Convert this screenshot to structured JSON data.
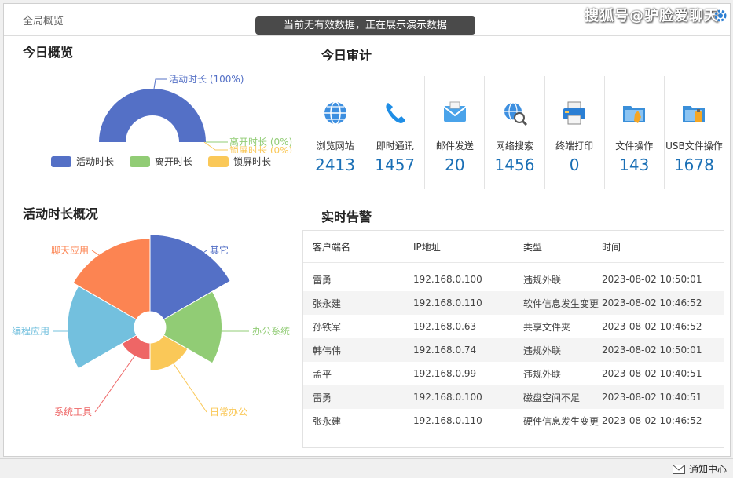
{
  "header": {
    "breadcrumb": "全局概览",
    "toast": "当前无有效数据，正在展示演示数据",
    "watermark": "搜狐号@驴脸爱聊天"
  },
  "overview": {
    "title": "今日概览",
    "chart_data": {
      "type": "pie",
      "title": "",
      "variant": "half-donut",
      "categories": [
        "活动时长",
        "离开时长",
        "锁屏时长"
      ],
      "values": [
        100,
        0,
        0
      ],
      "labels": [
        "活动时长 (100%)",
        "离开时长 (0%)",
        "锁屏时长 (0%)"
      ],
      "colors": [
        "#5470c6",
        "#91cc75",
        "#fac858"
      ],
      "legend_position": "bottom"
    }
  },
  "audit": {
    "title": "今日审计",
    "items": [
      {
        "label": "浏览网站",
        "value": "2413",
        "icon": "globe-icon"
      },
      {
        "label": "即时通讯",
        "value": "1457",
        "icon": "phone-icon"
      },
      {
        "label": "邮件发送",
        "value": "20",
        "icon": "mail-icon"
      },
      {
        "label": "网络搜索",
        "value": "1456",
        "icon": "search-globe-icon"
      },
      {
        "label": "终端打印",
        "value": "0",
        "icon": "printer-icon"
      },
      {
        "label": "文件操作",
        "value": "143",
        "icon": "folder-icon"
      },
      {
        "label": "USB文件操作",
        "value": "1678",
        "icon": "usb-folder-icon"
      }
    ]
  },
  "activity": {
    "title": "活动时长概况",
    "chart_data": {
      "type": "pie",
      "title": "",
      "variant": "rose",
      "categories": [
        "其它",
        "办公系统",
        "日常办公",
        "系统工具",
        "编程应用",
        "聊天应用"
      ],
      "values": [
        100,
        73,
        36,
        22,
        87,
        95
      ],
      "colors": [
        "#5470c6",
        "#91cc75",
        "#fac858",
        "#ee6666",
        "#73c0de",
        "#fc8452"
      ],
      "legend_position": "none"
    }
  },
  "alerts": {
    "title": "实时告警",
    "columns": [
      "客户端名",
      "IP地址",
      "类型",
      "时间"
    ],
    "rows": [
      [
        "雷勇",
        "192.168.0.100",
        "违规外联",
        "2023-08-02 10:50:01"
      ],
      [
        "张永建",
        "192.168.0.110",
        "软件信息发生变更",
        "2023-08-02 10:46:52"
      ],
      [
        "孙铁军",
        "192.168.0.63",
        "共享文件夹",
        "2023-08-02 10:46:52"
      ],
      [
        "韩伟伟",
        "192.168.0.74",
        "违规外联",
        "2023-08-02 10:50:01"
      ],
      [
        "孟平",
        "192.168.0.99",
        "违规外联",
        "2023-08-02 10:40:51"
      ],
      [
        "雷勇",
        "192.168.0.100",
        "磁盘空间不足",
        "2023-08-02 10:40:51"
      ],
      [
        "张永建",
        "192.168.0.110",
        "硬件信息发生变更",
        "2023-08-02 10:46:52"
      ]
    ]
  },
  "statusbar": {
    "notify_label": "通知中心"
  }
}
